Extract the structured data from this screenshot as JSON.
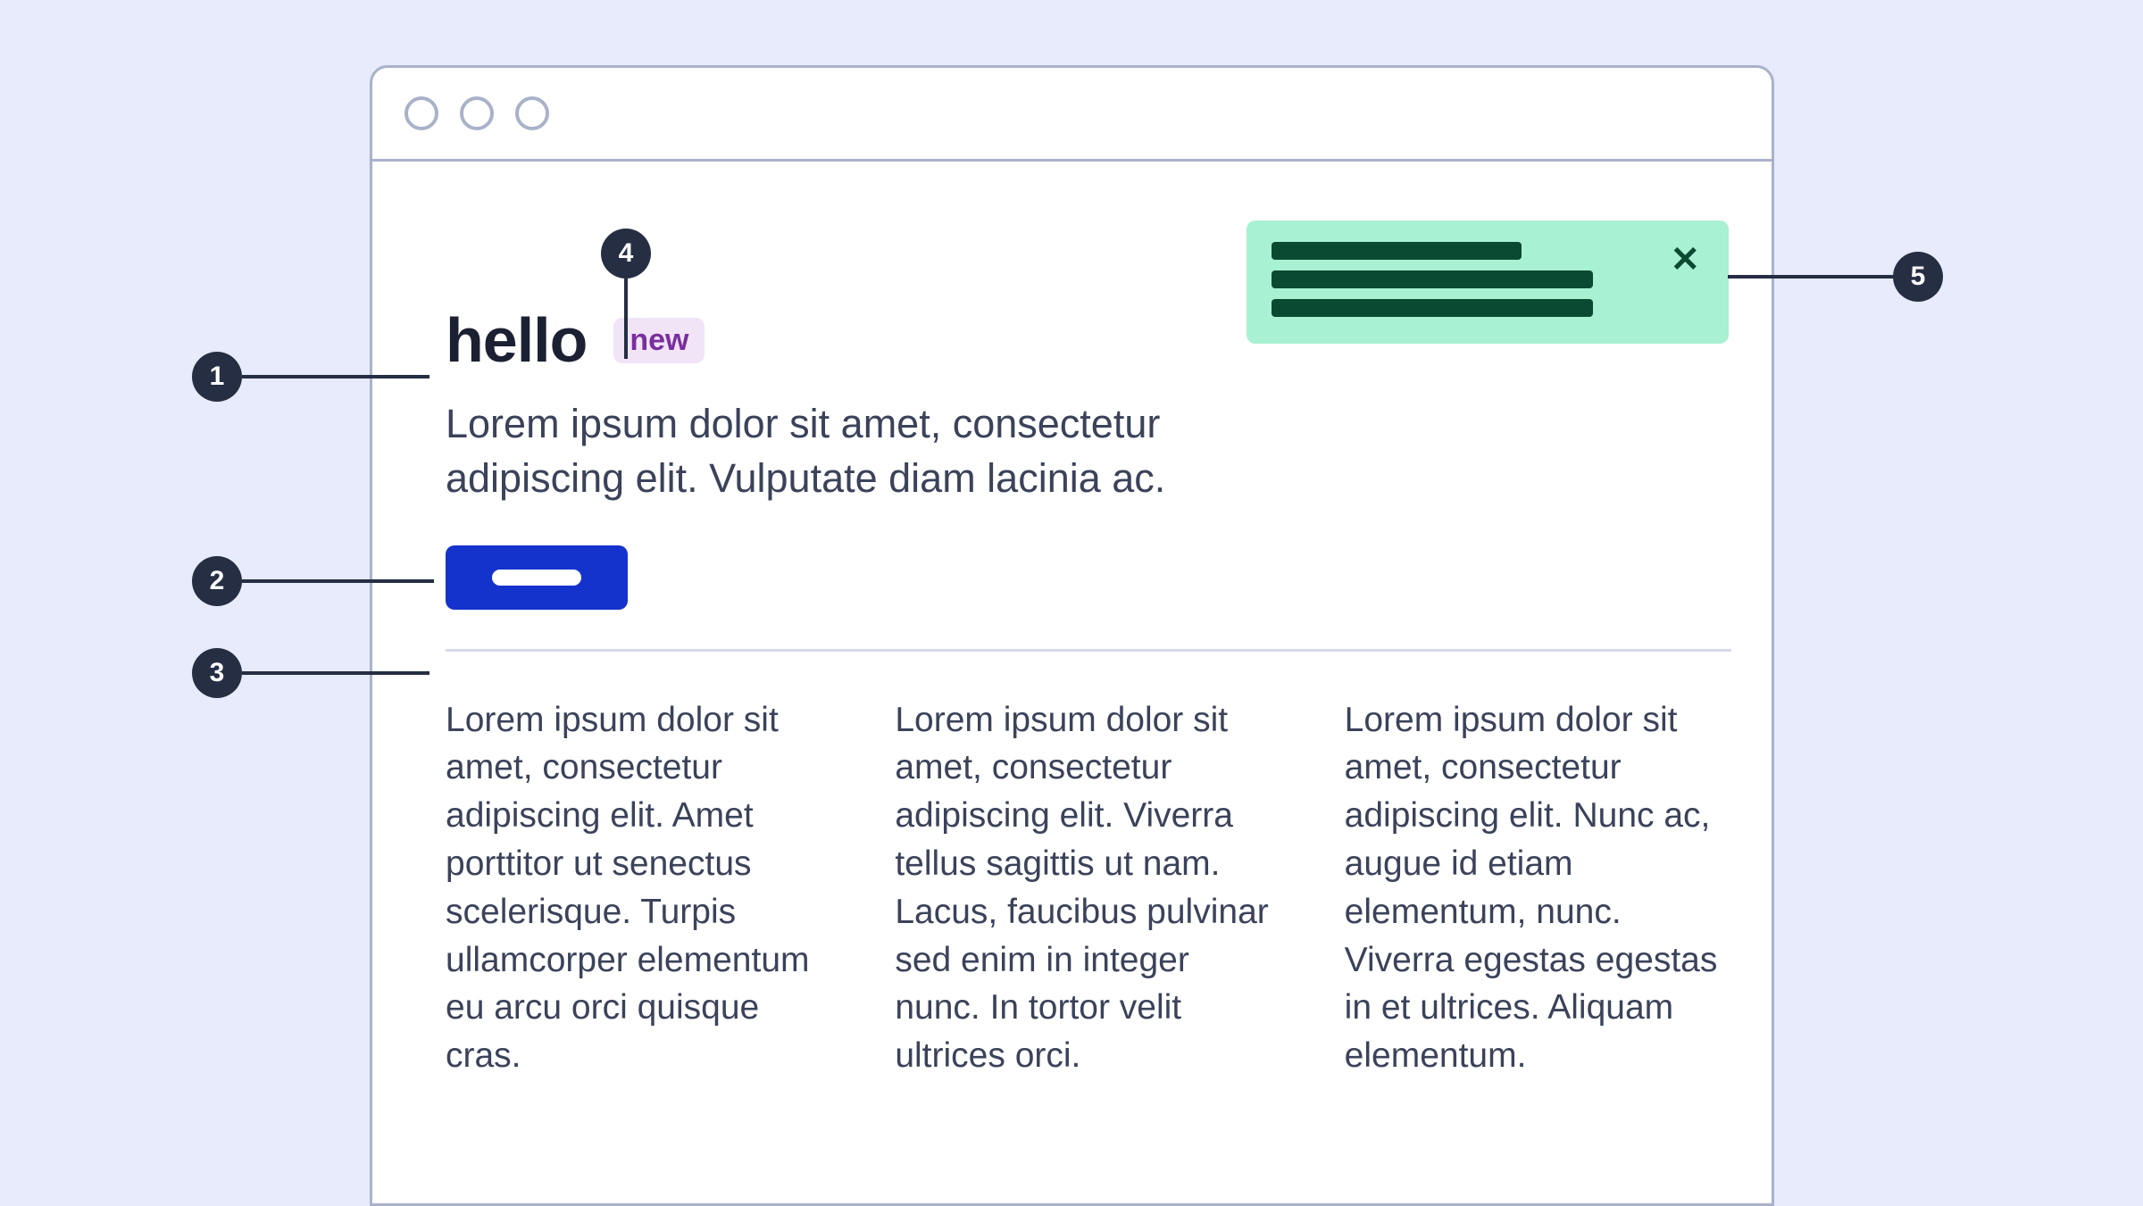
{
  "annotations": [
    {
      "num": "1"
    },
    {
      "num": "2"
    },
    {
      "num": "3"
    },
    {
      "num": "4"
    },
    {
      "num": "5"
    }
  ],
  "page": {
    "title": "hello",
    "badge": "new",
    "intro": "Lorem ipsum dolor sit amet, consectetur adipiscing elit. Vulputate diam lacinia ac.",
    "columns": [
      "Lorem ipsum dolor sit amet, consectetur adipiscing elit. Amet porttitor ut senectus scelerisque. Turpis ullamcorper elementum eu arcu orci quisque cras.",
      "Lorem ipsum dolor sit amet, consectetur adipiscing elit. Viverra tellus sagittis ut nam. Lacus, faucibus pulvinar sed enim in integer nunc. In tortor velit ultrices orci.",
      "Lorem ipsum dolor sit amet, consectetur adipiscing elit. Nunc ac, augue id etiam elementum, nunc. Viverra egestas egestas in et ultrices. Aliquam elementum."
    ]
  },
  "toast": {
    "close_glyph": "✕"
  }
}
